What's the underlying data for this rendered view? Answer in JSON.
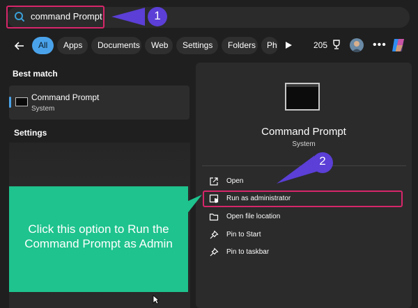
{
  "search": {
    "query": "command Prompt"
  },
  "filters": {
    "chips": [
      {
        "label": "All",
        "active": true
      },
      {
        "label": "Apps",
        "active": false
      },
      {
        "label": "Documents",
        "active": false
      },
      {
        "label": "Web",
        "active": false
      },
      {
        "label": "Settings",
        "active": false
      },
      {
        "label": "Folders",
        "active": false
      },
      {
        "label": "Ph",
        "active": false
      }
    ],
    "points": "205"
  },
  "results": {
    "best_match_heading": "Best match",
    "best_match": {
      "title": "Command Prompt",
      "subtitle": "System"
    },
    "settings_heading": "Settings"
  },
  "detail": {
    "title": "Command Prompt",
    "subtitle": "System",
    "actions": [
      {
        "label": "Open",
        "icon": "open-external-icon"
      },
      {
        "label": "Run as administrator",
        "icon": "shield-window-icon"
      },
      {
        "label": "Open file location",
        "icon": "folder-icon"
      },
      {
        "label": "Pin to Start",
        "icon": "pin-icon"
      },
      {
        "label": "Pin to taskbar",
        "icon": "pin-icon"
      }
    ]
  },
  "annotations": {
    "step1": "1",
    "step2": "2",
    "callout": "Click this option to Run the Command Prompt as Admin",
    "highlight_color": "#d7266a",
    "pointer_color": "#5b3fd6",
    "callout_color": "#1ec38d"
  },
  "colors": {
    "accent": "#4aa3ea",
    "background": "#1f1f1f",
    "panel": "#2b2b2b"
  }
}
